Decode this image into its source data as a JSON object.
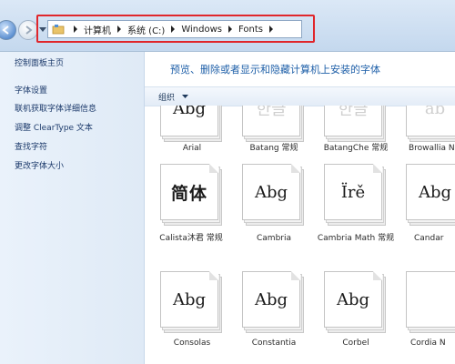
{
  "breadcrumbs": [
    "计算机",
    "系统 (C:)",
    "Windows",
    "Fonts"
  ],
  "accent_color": "#e0262b",
  "left_pane": {
    "home_link": "控制面板主页",
    "links": [
      "字体设置",
      "联机获取字体详细信息",
      "调整 ClearType 文本",
      "查找字符",
      "更改字体大小"
    ]
  },
  "main": {
    "heading": "预览、删除或者显示和隐藏计算机上安装的字体",
    "organize_label": "组织"
  },
  "fonts_row1": [
    {
      "sample": "Abg",
      "name": "Arial"
    },
    {
      "sample": "한글",
      "name": "Batang 常规"
    },
    {
      "sample": "한글",
      "name": "BatangChe 常规"
    },
    {
      "sample": "ab",
      "name": "Browallia N"
    }
  ],
  "fonts_row2": [
    {
      "sample": "简体",
      "name": "Calista沐君 常规"
    },
    {
      "sample": "Abg",
      "name": "Cambria"
    },
    {
      "sample": "Ïrě",
      "name": "Cambria Math 常规"
    },
    {
      "sample": "Abg",
      "name": "Candar"
    }
  ],
  "fonts_row3": [
    {
      "sample": "Abg",
      "name": "Consolas"
    },
    {
      "sample": "Abg",
      "name": "Constantia"
    },
    {
      "sample": "Abg",
      "name": "Corbel"
    },
    {
      "sample": "",
      "name": "Cordia N"
    }
  ]
}
